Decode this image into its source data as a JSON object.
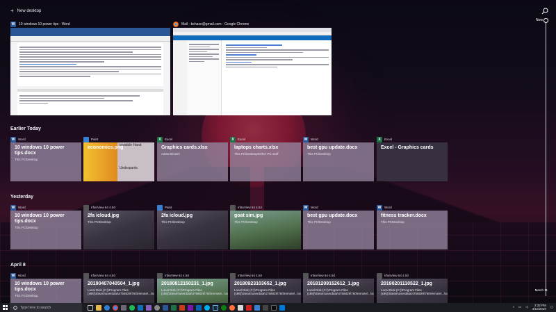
{
  "header": {
    "new_desktop_label": "New desktop"
  },
  "open_windows": [
    {
      "app": "Word",
      "title": "10 windows 10 power tips - Word"
    },
    {
      "app": "Chrome",
      "title": "Mail - bchase@gmail.com - Google Chrome"
    }
  ],
  "sections": [
    {
      "title": "Earlier Today",
      "cards": [
        {
          "app": "Word",
          "title": "10 windows 10 power tips.docx",
          "sub": "This PC\\Desktop",
          "style": "plain"
        },
        {
          "app": "Paint",
          "title": "economics.png",
          "sub": "",
          "style": "paint",
          "overlay1": "Invisible Hand",
          "overlay2": "Underpants"
        },
        {
          "app": "Excel",
          "title": "Graphics cards.xlsx",
          "sub": "Admin\\Downl",
          "style": "plain"
        },
        {
          "app": "Excel",
          "title": "laptops charts.xlsx",
          "sub": "This PC\\Desktop\\Other PC stuff",
          "style": "plain"
        },
        {
          "app": "Word",
          "title": "best gpu update.docx",
          "sub": "This PC\\Desktop",
          "style": "plain"
        },
        {
          "app": "Excel",
          "title": "Excel - Graphics cards",
          "sub": "",
          "style": "dark"
        }
      ]
    },
    {
      "title": "Yesterday",
      "cards": [
        {
          "app": "Word",
          "title": "10 windows 10 power tips.docx",
          "sub": "This PC\\Desktop",
          "style": "plain"
        },
        {
          "app": "IrfanView 64 4.50",
          "title": "2fa icloud.jpg",
          "sub": "This PC\\Desktop",
          "style": "photo-dark"
        },
        {
          "app": "Paint",
          "title": "2fa icloud.jpg",
          "sub": "This PC\\Desktop",
          "style": "photo-dark"
        },
        {
          "app": "IrfanView 64 4.52",
          "title": "goat sim.jpg",
          "sub": "This PC\\Desktop",
          "style": "photo-green"
        },
        {
          "app": "Word",
          "title": "best gpu update.docx",
          "sub": "This PC\\Desktop",
          "style": "plain"
        },
        {
          "app": "Word",
          "title": "fitness tracker.docx",
          "sub": "This PC\\Desktop",
          "style": "plain"
        }
      ]
    },
    {
      "title": "April 8",
      "cards": [
        {
          "app": "Word",
          "title": "10 windows 10 power tips.docx",
          "sub": "This PC\\Desktop",
          "style": "plain"
        },
        {
          "app": "IrfanView 64 4.50",
          "title": "20190407040504_1.jpg",
          "sub": "Local Disk (C:)\\Program Files (x86)\\Steam\\userdata\\4756829\\760\\remote\\...\\screenshots",
          "style": "photo-dark"
        },
        {
          "app": "IrfanView 64 4.50",
          "title": "20180812150231_1.jpg",
          "sub": "Local Disk (C:)\\Program Files (x86)\\Steam\\userdata\\4756829\\760\\remote\\...\\screenshots",
          "style": "photo-green"
        },
        {
          "app": "IrfanView 64 4.50",
          "title": "20180923103652_1.jpg",
          "sub": "Local Disk (C:)\\Program Files (x86)\\Steam\\userdata\\4756829\\760\\remote\\...\\screenshots",
          "style": "photo-dark"
        },
        {
          "app": "IrfanView 64 4.50",
          "title": "20181209152612_1.jpg",
          "sub": "Local Disk (C:)\\Program Files (x86)\\Steam\\userdata\\4756829\\760\\remote\\...\\screenshots",
          "style": "photo-dark"
        },
        {
          "app": "IrfanView 64 4.50",
          "title": "20190201110522_1.jpg",
          "sub": "Local Disk (C:)\\Program Files (x86)\\Steam\\userdata\\4756829\\760\\remote\\...\\screenshots",
          "style": "photo-dark"
        }
      ]
    }
  ],
  "scrubber": {
    "top_label": "Now",
    "bottom_label": "March 11"
  },
  "taskbar": {
    "search_placeholder": "Type here to search",
    "time": "2:32 PM",
    "date": "4/10/2019"
  },
  "colors": {
    "accent": "#0f6cbd",
    "card": "#9687a0",
    "taskbar": "#1b1b22"
  }
}
